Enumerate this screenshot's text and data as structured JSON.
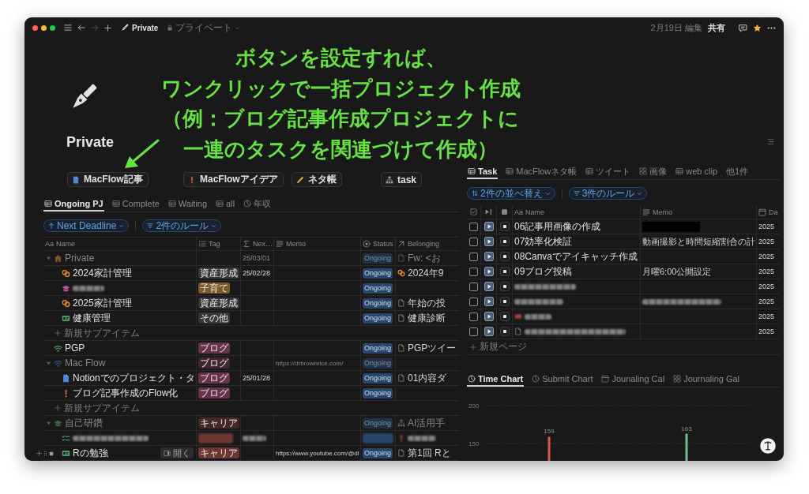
{
  "window": {
    "title": "Private",
    "privacy": "プライベート",
    "edited": "2月19日 編集",
    "share": "共有",
    "favorite": true,
    "forward_disabled": true
  },
  "annotation": {
    "lines": [
      "ボタンを設定すれば、",
      "ワンクリックで一括プロジェクト作成",
      "（例：ブログ記事作成プロジェクトに",
      "一連のタスクを関連づけて作成）"
    ]
  },
  "page": {
    "title": "Private"
  },
  "buttons": [
    {
      "label": "MacFlow記事"
    },
    {
      "label": "MacFlowアイデア"
    },
    {
      "label": "ネタ帳"
    },
    {
      "label": "task"
    }
  ],
  "projects": {
    "tabs": [
      {
        "label": "Ongoing PJ",
        "kind": "table",
        "selected": true
      },
      {
        "label": "Complete",
        "kind": "table",
        "selected": false
      },
      {
        "label": "Waiting",
        "kind": "table",
        "selected": false
      },
      {
        "label": "all",
        "kind": "table",
        "selected": false
      },
      {
        "label": "年収",
        "kind": "chart",
        "selected": false
      }
    ],
    "sort": "Next Deadline",
    "filter": "2件のルール",
    "columns": [
      {
        "kind": "title",
        "prefix": "Aa",
        "label": "Name"
      },
      {
        "kind": "multi_select",
        "label": "Tag"
      },
      {
        "kind": "formula",
        "label": "Nex…"
      },
      {
        "kind": "text",
        "label": "Memo"
      },
      {
        "kind": "status",
        "label": "Status"
      },
      {
        "kind": "relation",
        "label": "Belonging"
      }
    ],
    "rows": [
      {
        "name": "Private",
        "blurred": false,
        "greyed": true,
        "hovered": false,
        "expanded": true,
        "next": "25/03/01",
        "status": "Ongoing",
        "belonging": "Fw: <お",
        "add_label": "新規サブアイテム",
        "children": [
          {
            "name": "2024家計管理",
            "blurred": false,
            "greyed": false,
            "hovered": false,
            "tag": {
              "label": "資産形成",
              "color": "#373737"
            },
            "next": "25/02/28",
            "status": "Ongoing",
            "belonging": "2024年9"
          },
          {
            "blurred": true,
            "greyed": false,
            "hovered": false,
            "tag": {
              "label": "子育て",
              "color": "#7d5a2b"
            },
            "status": "Ongoing"
          },
          {
            "name": "2025家計管理",
            "blurred": false,
            "greyed": false,
            "hovered": false,
            "tag": {
              "label": "資産形成",
              "color": "#373737"
            },
            "status": "Ongoing",
            "belonging": "年始の投"
          },
          {
            "name": "健康管理",
            "blurred": false,
            "greyed": false,
            "hovered": false,
            "tag": {
              "label": "その他",
              "color": "#373737"
            },
            "status": "Ongoing",
            "belonging": "健康診断"
          }
        ]
      },
      {
        "name": "PGP",
        "blurred": false,
        "greyed": false,
        "hovered": false,
        "tag": {
          "label": "ブログ",
          "color": "#69314c"
        },
        "status": "Ongoing",
        "belonging": "PGPツイー"
      },
      {
        "name": "Mac Flow",
        "blurred": false,
        "greyed": true,
        "hovered": false,
        "expanded": true,
        "tag": {
          "label": "ブログ",
          "color": "#432633"
        },
        "memo": "https://drbrownrice.com/",
        "status": "Ongoing",
        "add_label": "新規サブアイテム",
        "children": [
          {
            "name": "Notionでのプロジェクト・タ",
            "blurred": false,
            "greyed": false,
            "hovered": false,
            "tag": {
              "label": "ブログ",
              "color": "#69314c"
            },
            "next": "25/01/28",
            "status": "Ongoing",
            "belonging": "01内容ダ"
          },
          {
            "name": "ブログ記事作成のFlow化",
            "blurred": false,
            "greyed": false,
            "hovered": false,
            "tag": {
              "label": "ブログ",
              "color": "#69314c"
            },
            "status": "Ongoing"
          }
        ]
      },
      {
        "name": "自己研鑽",
        "blurred": false,
        "greyed": true,
        "hovered": false,
        "expanded": true,
        "tag": {
          "label": "キャリア",
          "color": "#462926"
        },
        "status": "Ongoing",
        "belonging": "AI活用手",
        "children": [
          {
            "blurred": true,
            "cells_blurred": true,
            "greyed": false,
            "hovered": false,
            "tag": {
              "color": "#6e3630"
            }
          },
          {
            "name": "Rの勉強",
            "blurred": false,
            "greyed": false,
            "hovered": true,
            "open_label": "開く",
            "tag": {
              "label": "キャリア",
              "color": "#6e3630"
            },
            "memo": "https://www.youtube.com/@dl",
            "status": "Ongoing",
            "belonging": "第1回 Rと"
          }
        ]
      }
    ]
  },
  "tasks": {
    "tabs": [
      {
        "label": "Task",
        "kind": "table",
        "selected": true
      },
      {
        "label": "MacFlowネタ帳",
        "kind": "table",
        "selected": false
      },
      {
        "label": "ツイート",
        "kind": "table",
        "selected": false
      },
      {
        "label": "画像",
        "kind": "gallery",
        "selected": false
      },
      {
        "label": "web clip",
        "kind": "table",
        "selected": false
      },
      {
        "label": "他1件",
        "kind": "more",
        "selected": false
      }
    ],
    "sort": "2件の並べ替え",
    "filter": "3件のルール",
    "columns": [
      {
        "kind": "checkbox"
      },
      {
        "kind": "play_button"
      },
      {
        "kind": "stop_button"
      },
      {
        "kind": "title",
        "prefix": "Aa",
        "label": "Name"
      },
      {
        "kind": "text",
        "label": "Memo"
      },
      {
        "kind": "date",
        "label": "Da"
      }
    ],
    "rows": [
      {
        "checked": false,
        "blurred": false,
        "name": "06記事用画像の作成",
        "memo_blacked_out": true,
        "date": "2025"
      },
      {
        "checked": false,
        "blurred": false,
        "name": "07効率化検証",
        "memo": "動画撮影と時間短縮割合の計",
        "date": "2025"
      },
      {
        "checked": false,
        "blurred": false,
        "name": "08Canvaでアイキャッチ作成",
        "date": "2025"
      },
      {
        "checked": false,
        "blurred": false,
        "name": "09ブログ投稿",
        "memo": "月曜6:00公開設定",
        "date": "2025"
      },
      {
        "checked": false,
        "blurred": true,
        "date": "2025"
      },
      {
        "checked": false,
        "blurred": true,
        "memo_blurred": true,
        "date": "2025"
      },
      {
        "checked": false,
        "blurred": true,
        "date": "2025"
      },
      {
        "checked": false,
        "blurred": true,
        "date": "2025"
      }
    ],
    "add_label": "新規ページ"
  },
  "charts": {
    "tabs": [
      {
        "label": "Time Chart",
        "kind": "chart",
        "selected": true
      },
      {
        "label": "Submit Chart",
        "kind": "chart",
        "selected": false
      },
      {
        "label": "Jounaling Cal",
        "kind": "calendar",
        "selected": false
      },
      {
        "label": "Journaling Gal",
        "kind": "gallery",
        "selected": false
      }
    ],
    "chart_data": {
      "type": "bar",
      "ylim": [
        124,
        200
      ],
      "yticks": [
        150,
        200
      ],
      "stacked": false,
      "series": [
        {
          "color": "#d9574c",
          "values": [
            159,
            null
          ]
        },
        {
          "color": "#6cc08b",
          "values": [
            null,
            163
          ]
        }
      ],
      "data_labels": true
    }
  }
}
